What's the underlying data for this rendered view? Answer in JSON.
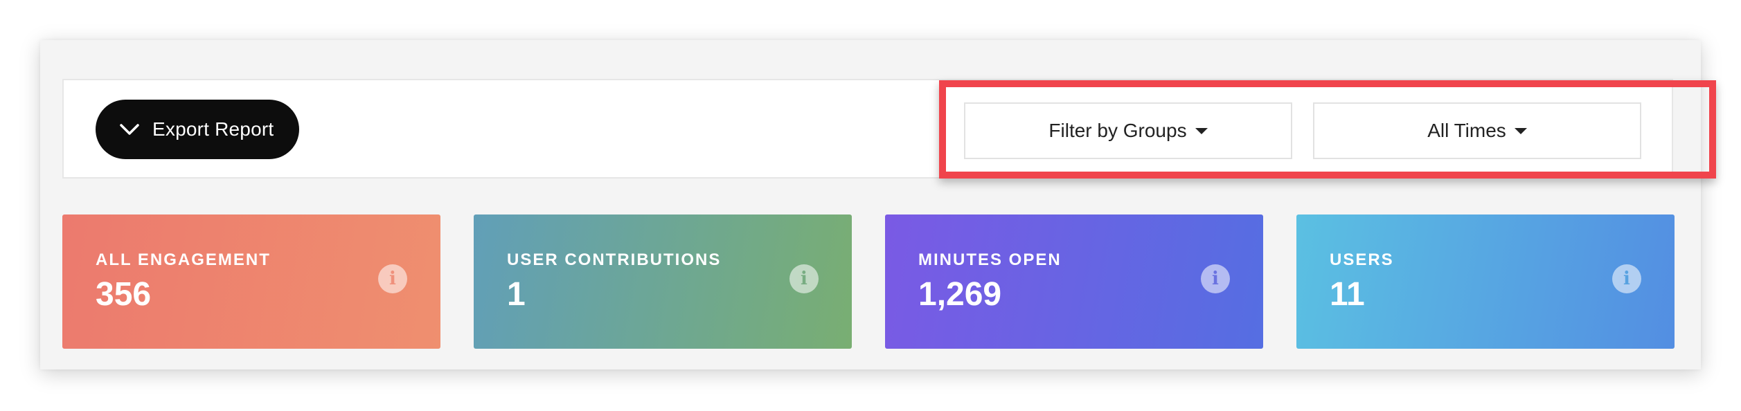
{
  "toolbar": {
    "export_label": "Export Report",
    "export_icon": "chevron-down-icon",
    "filters": {
      "groups_label": "Filter by Groups",
      "time_label": "All Times"
    },
    "highlight_color": "#f0444c"
  },
  "stats": [
    {
      "title": "ALL ENGAGEMENT",
      "value": "356",
      "info_icon": "info-icon",
      "colors": [
        "#ec7a6e",
        "#ef8f6f"
      ]
    },
    {
      "title": "USER CONTRIBUTIONS",
      "value": "1",
      "info_icon": "info-icon",
      "colors": [
        "#619fb8",
        "#79ae72"
      ]
    },
    {
      "title": "MINUTES OPEN",
      "value": "1,269",
      "info_icon": "info-icon",
      "colors": [
        "#7a5ae4",
        "#556ee2"
      ]
    },
    {
      "title": "USERS",
      "value": "11",
      "info_icon": "info-icon",
      "colors": [
        "#5bc0e2",
        "#538ee2"
      ]
    }
  ],
  "info_glyph": "i"
}
